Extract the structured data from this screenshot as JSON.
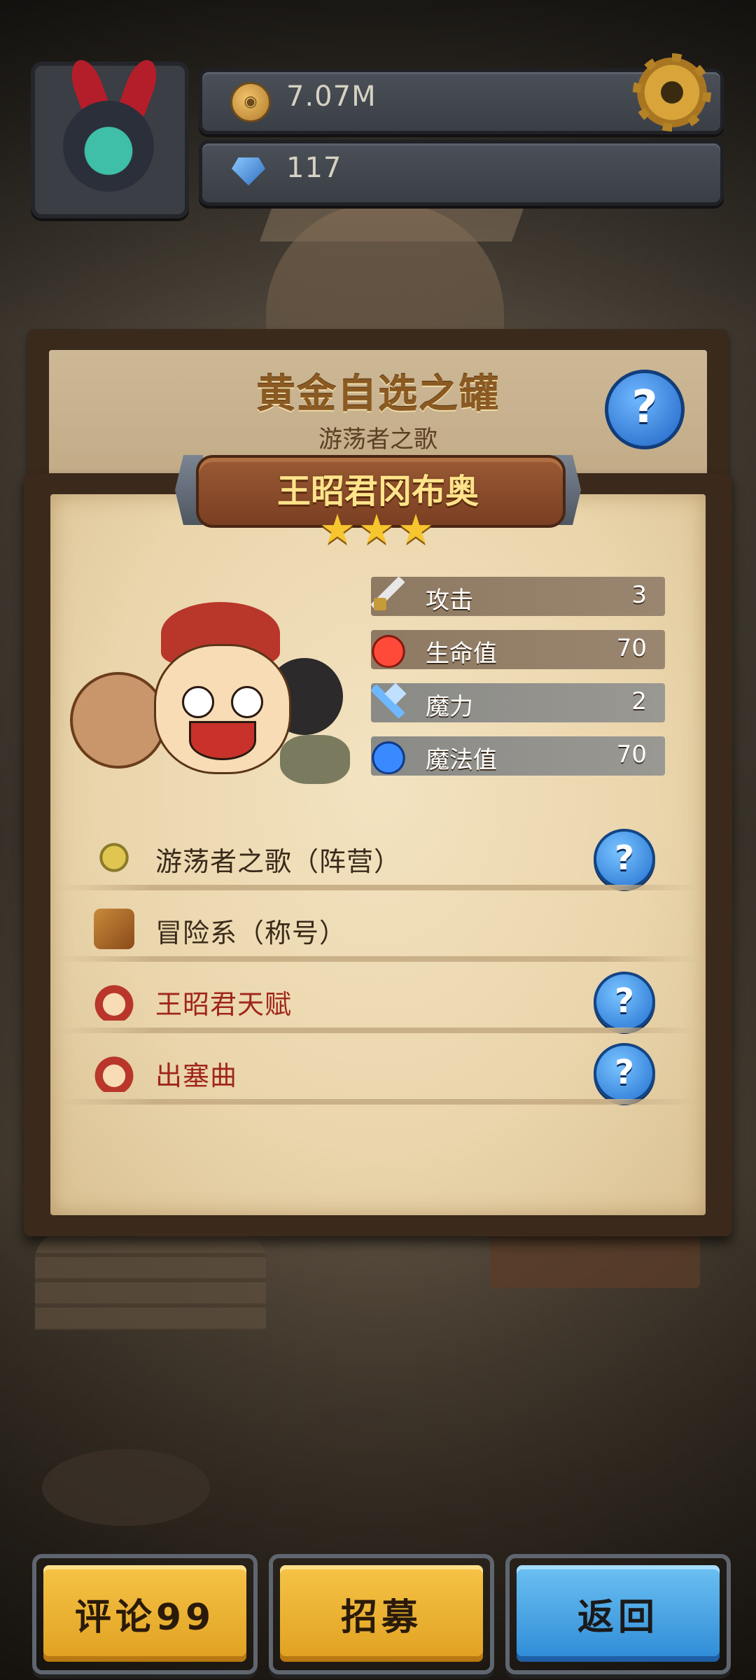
{
  "hud": {
    "coins": "7.07M",
    "gems": "117"
  },
  "pack": {
    "title": "黄金自选之罐",
    "subtitle": "游荡者之歌"
  },
  "hero": {
    "name": "王昭君冈布奥",
    "stars": "★★★",
    "star_count": 3
  },
  "stats": [
    {
      "label": "攻击",
      "value": "3",
      "icon": "sword-icon"
    },
    {
      "label": "生命值",
      "value": "70",
      "icon": "hp-potion-icon"
    },
    {
      "label": "魔力",
      "value": "2",
      "icon": "magic-wand-icon"
    },
    {
      "label": "魔法值",
      "value": "70",
      "icon": "mp-potion-icon"
    }
  ],
  "traits": [
    {
      "text": "游荡者之歌（阵营）",
      "icon": "faction-icon",
      "has_help": true
    },
    {
      "text": "冒险系（称号）",
      "icon": "title-badge-icon",
      "has_help": false
    },
    {
      "text": "王昭君天赋",
      "icon": "hero-talent-icon",
      "has_help": true
    },
    {
      "text": "出塞曲",
      "icon": "hero-skill-icon",
      "has_help": true
    }
  ],
  "help_glyph": "?",
  "buttons": {
    "comment": "评论99",
    "recruit": "招募",
    "back": "返回"
  },
  "colors": {
    "gold_button": "#e0a021",
    "blue_button": "#2d8ad6",
    "trait_red": "#a0261c",
    "hero_name": "#ffe38a"
  }
}
